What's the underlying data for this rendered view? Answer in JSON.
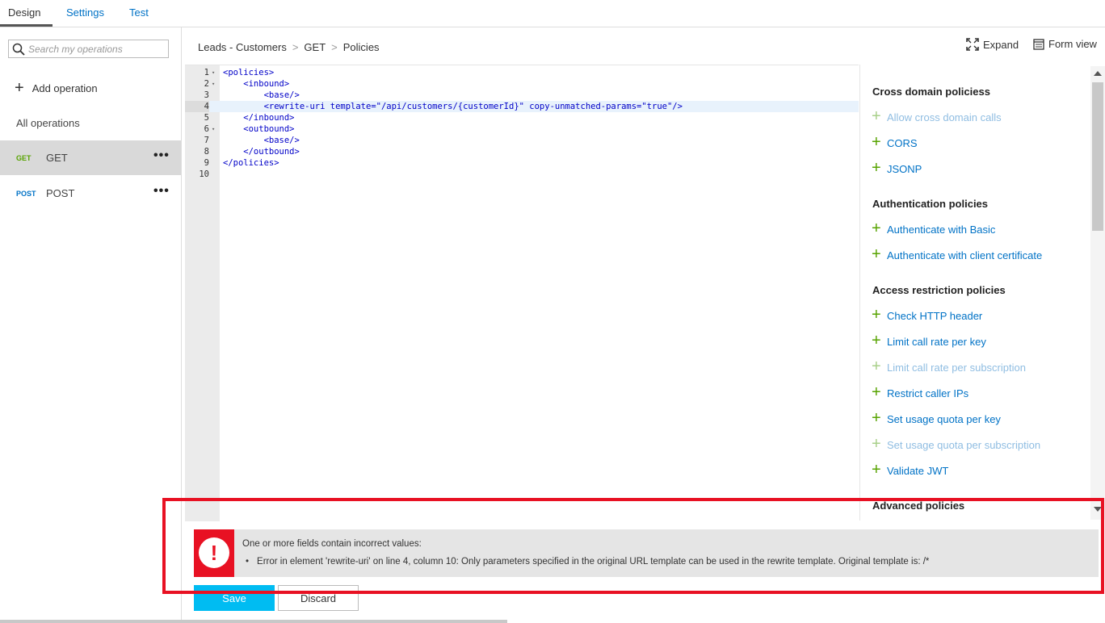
{
  "tabs": {
    "design": "Design",
    "settings": "Settings",
    "test": "Test"
  },
  "left": {
    "search_placeholder": "Search my operations",
    "add_operation": "Add operation",
    "all_operations": "All operations",
    "operations": [
      {
        "method": "GET",
        "name": "GET",
        "more": "•••"
      },
      {
        "method": "POST",
        "name": "POST",
        "more": "•••"
      }
    ]
  },
  "breadcrumb": {
    "api": "Leads - Customers",
    "operation": "GET",
    "section": "Policies",
    "separator": ">"
  },
  "header": {
    "expand": "Expand",
    "form_view": "Form view"
  },
  "editor": {
    "lines": [
      {
        "n": "1",
        "fold": "▾",
        "code": "<policies>"
      },
      {
        "n": "2",
        "fold": "▾",
        "code": "    <inbound>"
      },
      {
        "n": "3",
        "fold": "",
        "code": "        <base/>"
      },
      {
        "n": "4",
        "fold": "",
        "code": "        <rewrite-uri template=\"/api/customers/{customerId}\" copy-unmatched-params=\"true\"/>"
      },
      {
        "n": "5",
        "fold": "",
        "code": "    </inbound>"
      },
      {
        "n": "6",
        "fold": "▾",
        "code": "    <outbound>"
      },
      {
        "n": "7",
        "fold": "",
        "code": "        <base/>"
      },
      {
        "n": "8",
        "fold": "",
        "code": "    </outbound>"
      },
      {
        "n": "9",
        "fold": "",
        "code": "</policies>"
      },
      {
        "n": "10",
        "fold": "",
        "code": ""
      }
    ]
  },
  "policy_panel": {
    "cross_domain": "Cross domain policiess",
    "cross_domain_items": [
      "Allow cross domain calls",
      "CORS",
      "JSONP"
    ],
    "auth": "Authentication policies",
    "auth_items": [
      "Authenticate with Basic",
      "Authenticate with client certificate"
    ],
    "access": "Access restriction policies",
    "access_items": [
      "Check HTTP header",
      "Limit call rate per key",
      "Limit call rate per subscription",
      "Restrict caller IPs",
      "Set usage quota per key",
      "Set usage quota per subscription",
      "Validate JWT"
    ],
    "advanced": "Advanced policies"
  },
  "error": {
    "title": "One or more fields contain incorrect values:",
    "message": "Error in element 'rewrite-uri' on line 4, column 10: Only parameters specified in the original URL template can be used in the rewrite template. Original template is: /*",
    "icon": "!"
  },
  "buttons": {
    "save": "Save",
    "discard": "Discard"
  },
  "colors": {
    "accent": "#0072c6",
    "get": "#57a300",
    "error": "#e81123",
    "save": "#00bcf2"
  }
}
